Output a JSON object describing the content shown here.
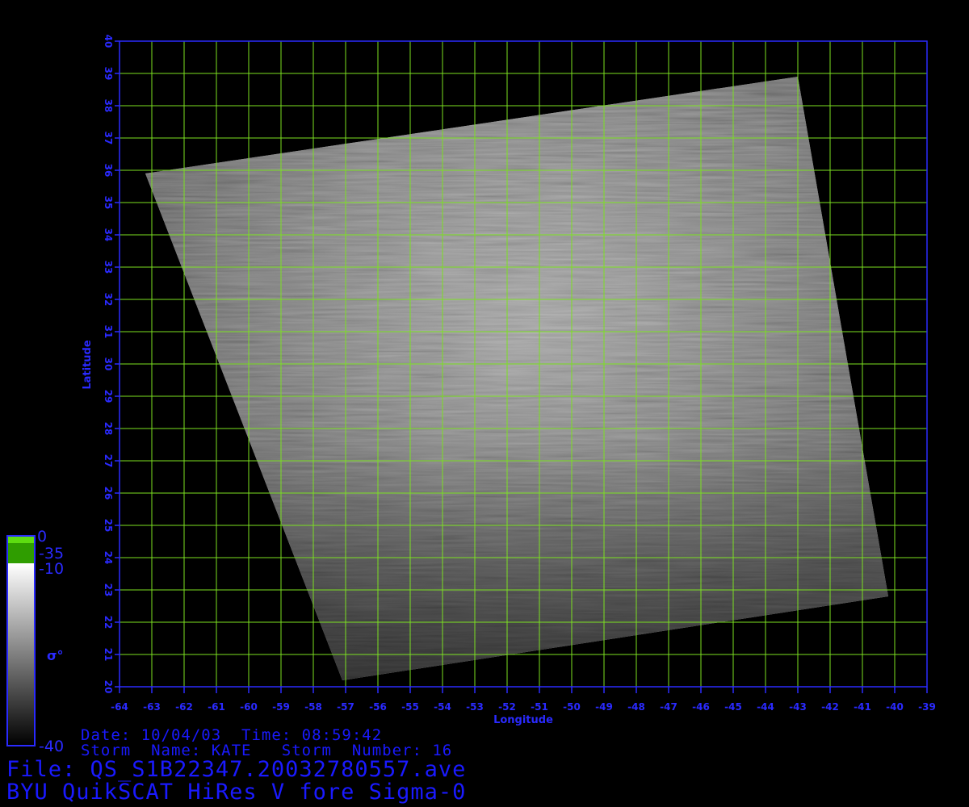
{
  "map": {
    "lon_min": -64,
    "lon_max": -39,
    "lat_min": 20,
    "lat_max": 40,
    "lon_ticks": [
      "-64",
      "-63",
      "-62",
      "-61",
      "-60",
      "-59",
      "-58",
      "-57",
      "-56",
      "-55",
      "-54",
      "-53",
      "-52",
      "-51",
      "-50",
      "-49",
      "-48",
      "-47",
      "-46",
      "-45",
      "-44",
      "-43",
      "-42",
      "-41",
      "-40",
      "-39"
    ],
    "lat_ticks": [
      "20",
      "21",
      "22",
      "23",
      "24",
      "25",
      "26",
      "27",
      "28",
      "29",
      "30",
      "31",
      "32",
      "33",
      "34",
      "35",
      "36",
      "37",
      "38",
      "39",
      "40"
    ],
    "xlabel": "Longitude",
    "ylabel": "Latitude",
    "grid_color": "#7be021",
    "frame_color": "#2a2aff",
    "swath_corners_lonlat": [
      [
        -63.2,
        35.9
      ],
      [
        -43.0,
        38.9
      ],
      [
        -40.2,
        22.8
      ],
      [
        -57.1,
        20.2
      ]
    ]
  },
  "colorbar": {
    "top_label": "0",
    "green_label": "-35",
    "white_label": "-10",
    "symbol": "σ°",
    "bottom_label": "-40",
    "green_color": "#2f9d00",
    "bright_green_color": "#5ddd10"
  },
  "info": {
    "date_line": "Date: 10/04/03  Time: 08:59:42",
    "storm_line": "Storm  Name: KATE   Storm  Number: 16",
    "file_line": "File: QS_S1B22347.20032780557.ave",
    "product_line": "BYU QuikSCAT HiRes V fore Sigma-0"
  }
}
